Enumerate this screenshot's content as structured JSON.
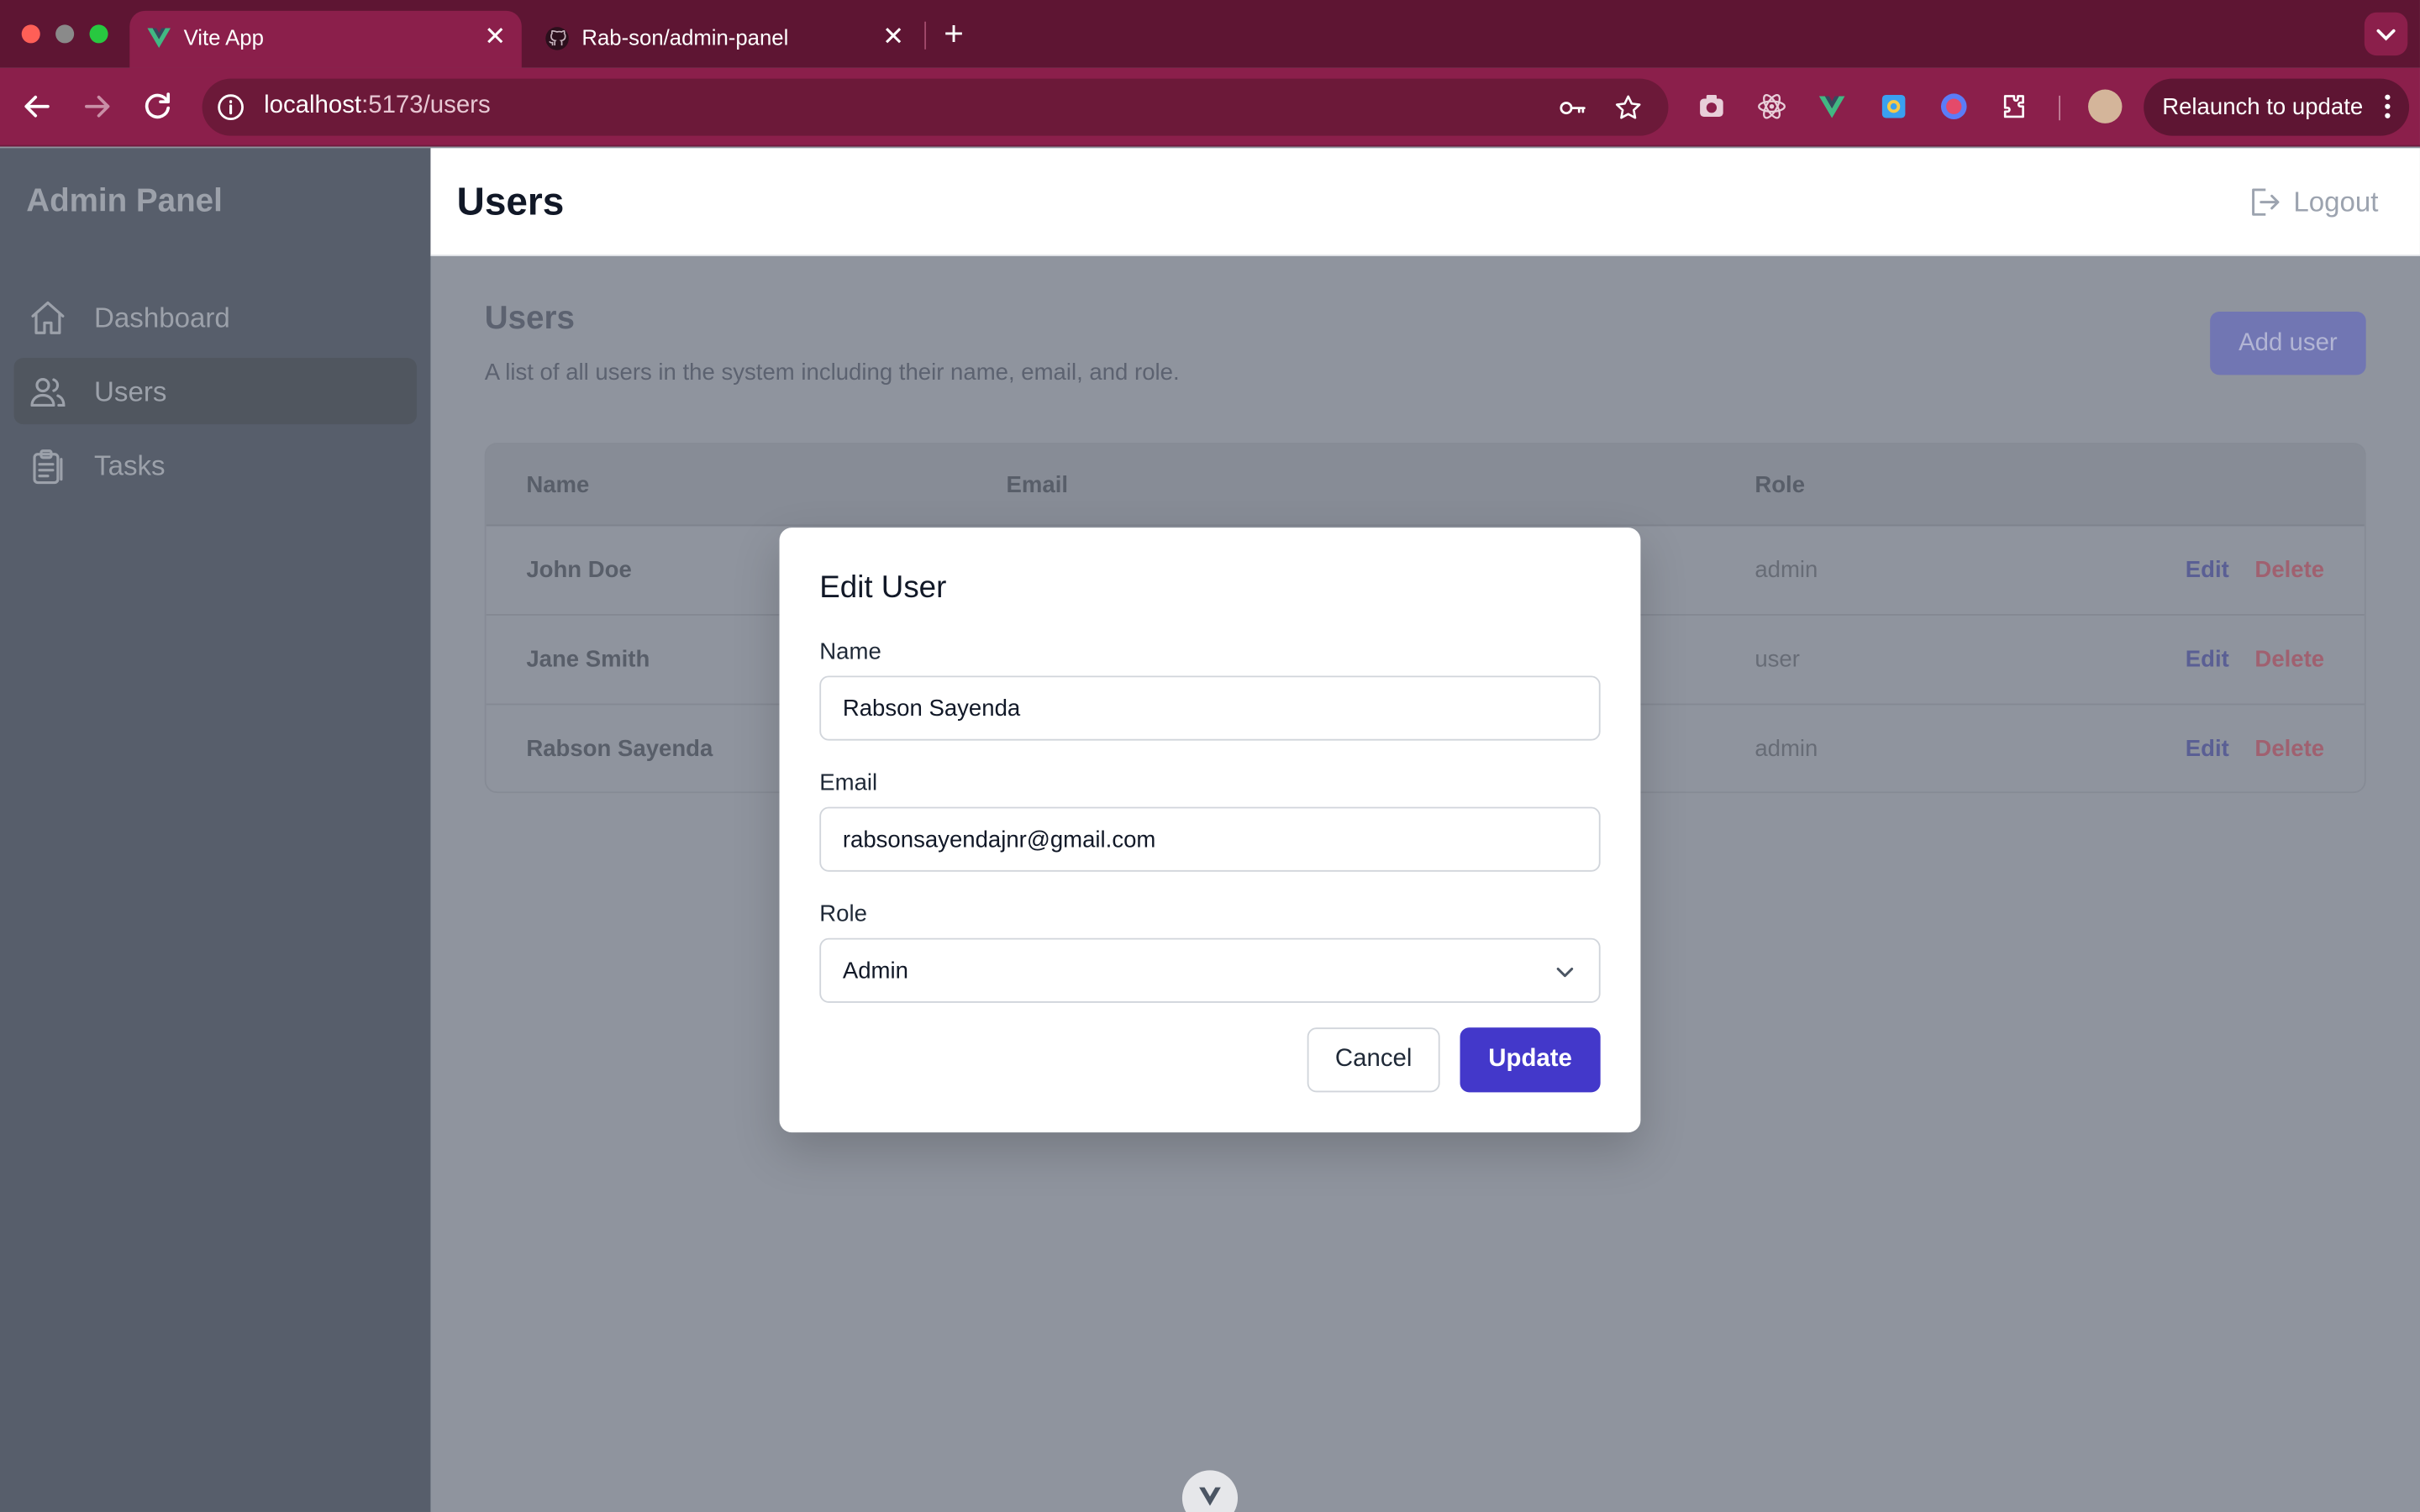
{
  "browser": {
    "tabs": [
      {
        "label": "Vite App",
        "icon": "vue-logo-icon",
        "active": true
      },
      {
        "label": "Rab-son/admin-panel",
        "icon": "github-icon",
        "active": false
      }
    ],
    "url_host": "localhost",
    "url_path": ":5173/users",
    "relaunch_label": "Relaunch to update",
    "colors": {
      "frame": "#5e1533",
      "toolbar": "#8b1f4b"
    }
  },
  "sidebar": {
    "brand": "Admin Panel",
    "items": [
      {
        "label": "Dashboard",
        "icon": "home-icon",
        "active": false
      },
      {
        "label": "Users",
        "icon": "users-icon",
        "active": true
      },
      {
        "label": "Tasks",
        "icon": "clipboard-icon",
        "active": false
      }
    ]
  },
  "header": {
    "title": "Users",
    "logout_label": "Logout"
  },
  "users_section": {
    "title": "Users",
    "description": "A list of all users in the system including their name, email, and role.",
    "add_button": "Add user",
    "columns": [
      "Name",
      "Email",
      "Role"
    ],
    "rows": [
      {
        "name": "John Doe",
        "role": "admin",
        "edit": "Edit",
        "delete": "Delete"
      },
      {
        "name": "Jane Smith",
        "role": "user",
        "edit": "Edit",
        "delete": "Delete"
      },
      {
        "name": "Rabson Sayenda",
        "role": "admin",
        "edit": "Edit",
        "delete": "Delete"
      }
    ]
  },
  "modal": {
    "title": "Edit User",
    "name_label": "Name",
    "name_value": "Rabson Sayenda",
    "email_label": "Email",
    "email_value": "rabsonsayendajnr@gmail.com",
    "role_label": "Role",
    "role_value": "Admin",
    "cancel_label": "Cancel",
    "update_label": "Update",
    "accent": "#4338ca"
  }
}
